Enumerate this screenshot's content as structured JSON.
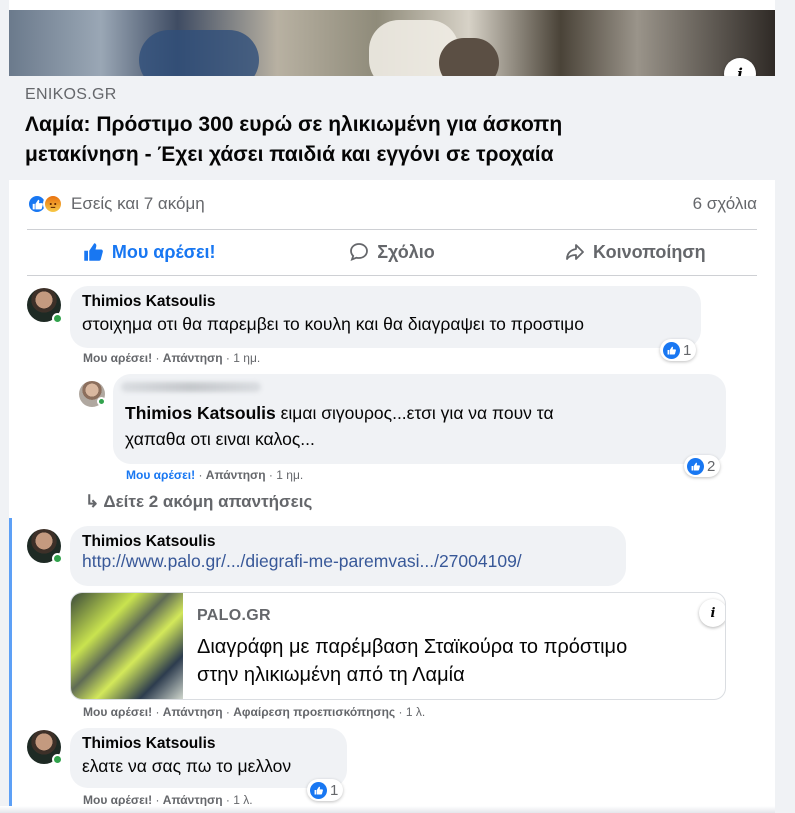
{
  "post": {
    "link_preview": {
      "domain": "ENIKOS.GR",
      "title_line1": "Λαμία: Πρόστιμο 300 ευρώ σε ηλικιωμένη για άσκοπη",
      "title_line2": "μετακίνηση - Έχει χάσει παιδιά και εγγόνι σε τροχαία",
      "info_icon": "i"
    },
    "reactions": {
      "icons": [
        "like-icon",
        "angry-icon"
      ],
      "text": "Εσείς και 7 ακόμη",
      "comments_count": "6 σχόλια"
    },
    "actions": {
      "like": "Μου αρέσει!",
      "comment": "Σχόλιο",
      "share": "Κοινοποίηση"
    }
  },
  "comments": [
    {
      "author": "Thimios Katsoulis",
      "text": "στοιχημα οτι θα παρεμβει το κουλη και θα διαγραψει το προστιμο",
      "meta": {
        "like": "Μου αρέσει!",
        "reply": "Απάντηση",
        "time": "1 ημ."
      },
      "reaction_count": "1"
    },
    {
      "reply_mention": "Thimios Katsoulis",
      "text_line1": " ειμαι σιγουρος...ετσι για να πουν τα",
      "text_line2": "χαπαθα οτι ειναι καλος...",
      "meta": {
        "like": "Μου αρέσει!",
        "reply": "Απάντηση",
        "time": "1 ημ."
      },
      "reaction_count": "2"
    },
    {
      "more_replies": "Δείτε 2 ακόμη απαντήσεις"
    },
    {
      "author": "Thimios Katsoulis",
      "link": "http://www.palo.gr/.../diegrafi-me-paremvasi.../27004109/",
      "card": {
        "domain": "PALO.GR",
        "title_line1": "Διαγράφη με παρέμβαση Σταϊκούρα το πρόστιμο",
        "title_line2": "στην ηλικιωμένη από τη Λαμία",
        "info_icon": "i"
      },
      "meta": {
        "like": "Μου αρέσει!",
        "reply": "Απάντηση",
        "remove_preview": "Αφαίρεση προεπισκόπησης",
        "time": "1 λ."
      }
    },
    {
      "author": "Thimios Katsoulis",
      "text": "ελατε να σας πω το μελλον",
      "meta": {
        "like": "Μου αρέσει!",
        "reply": "Απάντηση",
        "time": "1 λ."
      },
      "reaction_count": "1"
    }
  ],
  "symbols": {
    "dot": "·",
    "reply_arrow": "↳"
  },
  "colors": {
    "accent": "#1877f2",
    "online": "#31a24c",
    "bubble": "#f0f2f5",
    "secondary_text": "#65676b"
  }
}
